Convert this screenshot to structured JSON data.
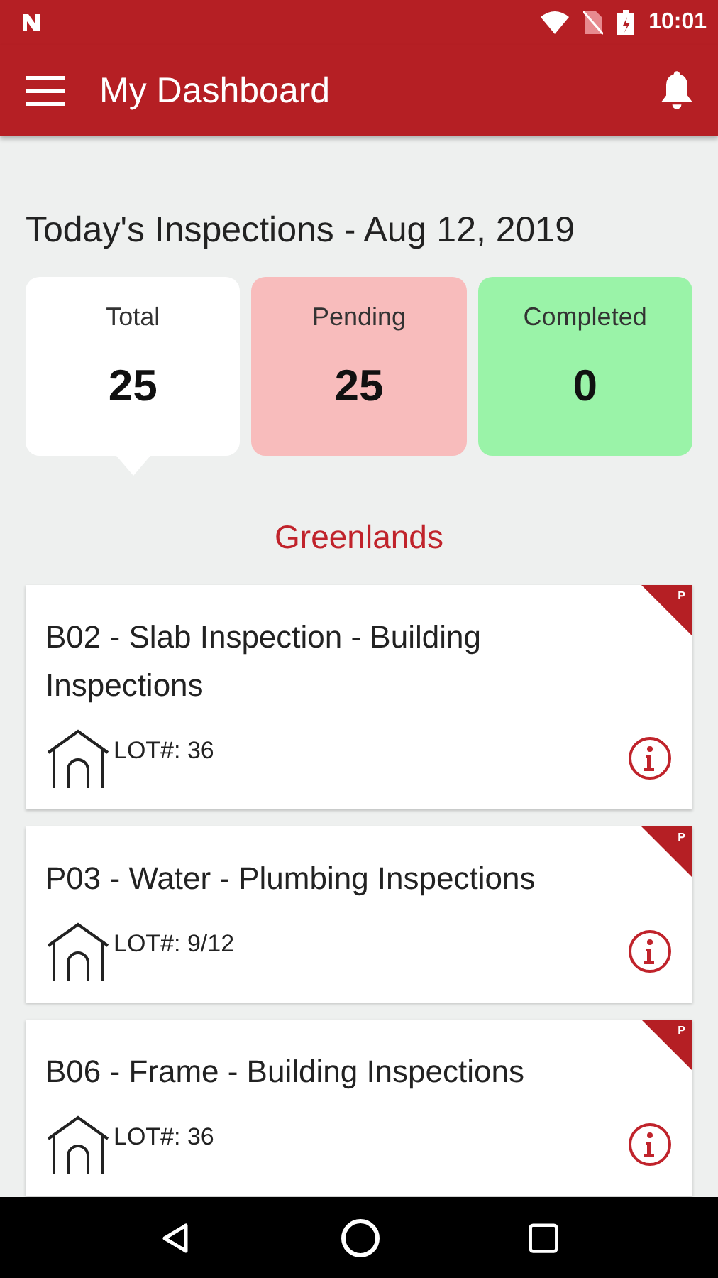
{
  "status_bar": {
    "time": "10:01"
  },
  "toolbar": {
    "title": "My Dashboard"
  },
  "heading": "Today's Inspections - Aug 12, 2019",
  "stats": [
    {
      "label": "Total",
      "value": "25",
      "color": "#ffffff",
      "selected": true
    },
    {
      "label": "Pending",
      "value": "25",
      "color": "#f8bcbc",
      "selected": false
    },
    {
      "label": "Completed",
      "value": "0",
      "color": "#9af3a8",
      "selected": false
    }
  ],
  "section": "Greenlands",
  "inspections": [
    {
      "title": "B02 - Slab Inspection - Building Inspections",
      "lot": "LOT#: 36",
      "badge": "P"
    },
    {
      "title": "P03 - Water - Plumbing Inspections",
      "lot": "LOT#: 9/12",
      "badge": "P"
    },
    {
      "title": "B06 - Frame - Building Inspections",
      "lot": "LOT#: 36",
      "badge": "P"
    }
  ]
}
